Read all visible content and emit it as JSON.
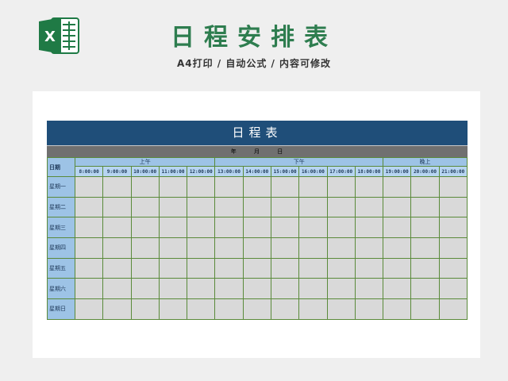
{
  "header": {
    "title": "日程安排表",
    "subtitle": "A4打印 / 自动公式 / 内容可修改"
  },
  "logo": {
    "letter": "X",
    "icon": "excel-icon",
    "color": "#1f7a45"
  },
  "schedule": {
    "banner": "日程表",
    "date_line": {
      "year": "年",
      "month": "月",
      "day": "日"
    },
    "date_col_label": "日期",
    "periods": [
      {
        "label": "上午",
        "span": 5
      },
      {
        "label": "下午",
        "span": 6
      },
      {
        "label": "晚上",
        "span": 3
      }
    ],
    "times": [
      "8:00:00",
      "9:00:00",
      "10:00:00",
      "11:00:00",
      "12:00:00",
      "13:00:00",
      "14:00:00",
      "15:00:00",
      "16:00:00",
      "17:00:00",
      "18:00:00",
      "19:00:00",
      "20:00:00",
      "21:00:00"
    ],
    "days": [
      "星期一",
      "星期二",
      "星期三",
      "星期四",
      "星期五",
      "星期六",
      "星期日"
    ]
  },
  "colors": {
    "title": "#2e7d4f",
    "banner": "#1f4e79",
    "header": "#9dc3e6",
    "cell": "#d9d9d9",
    "border": "#5a8a3a"
  }
}
